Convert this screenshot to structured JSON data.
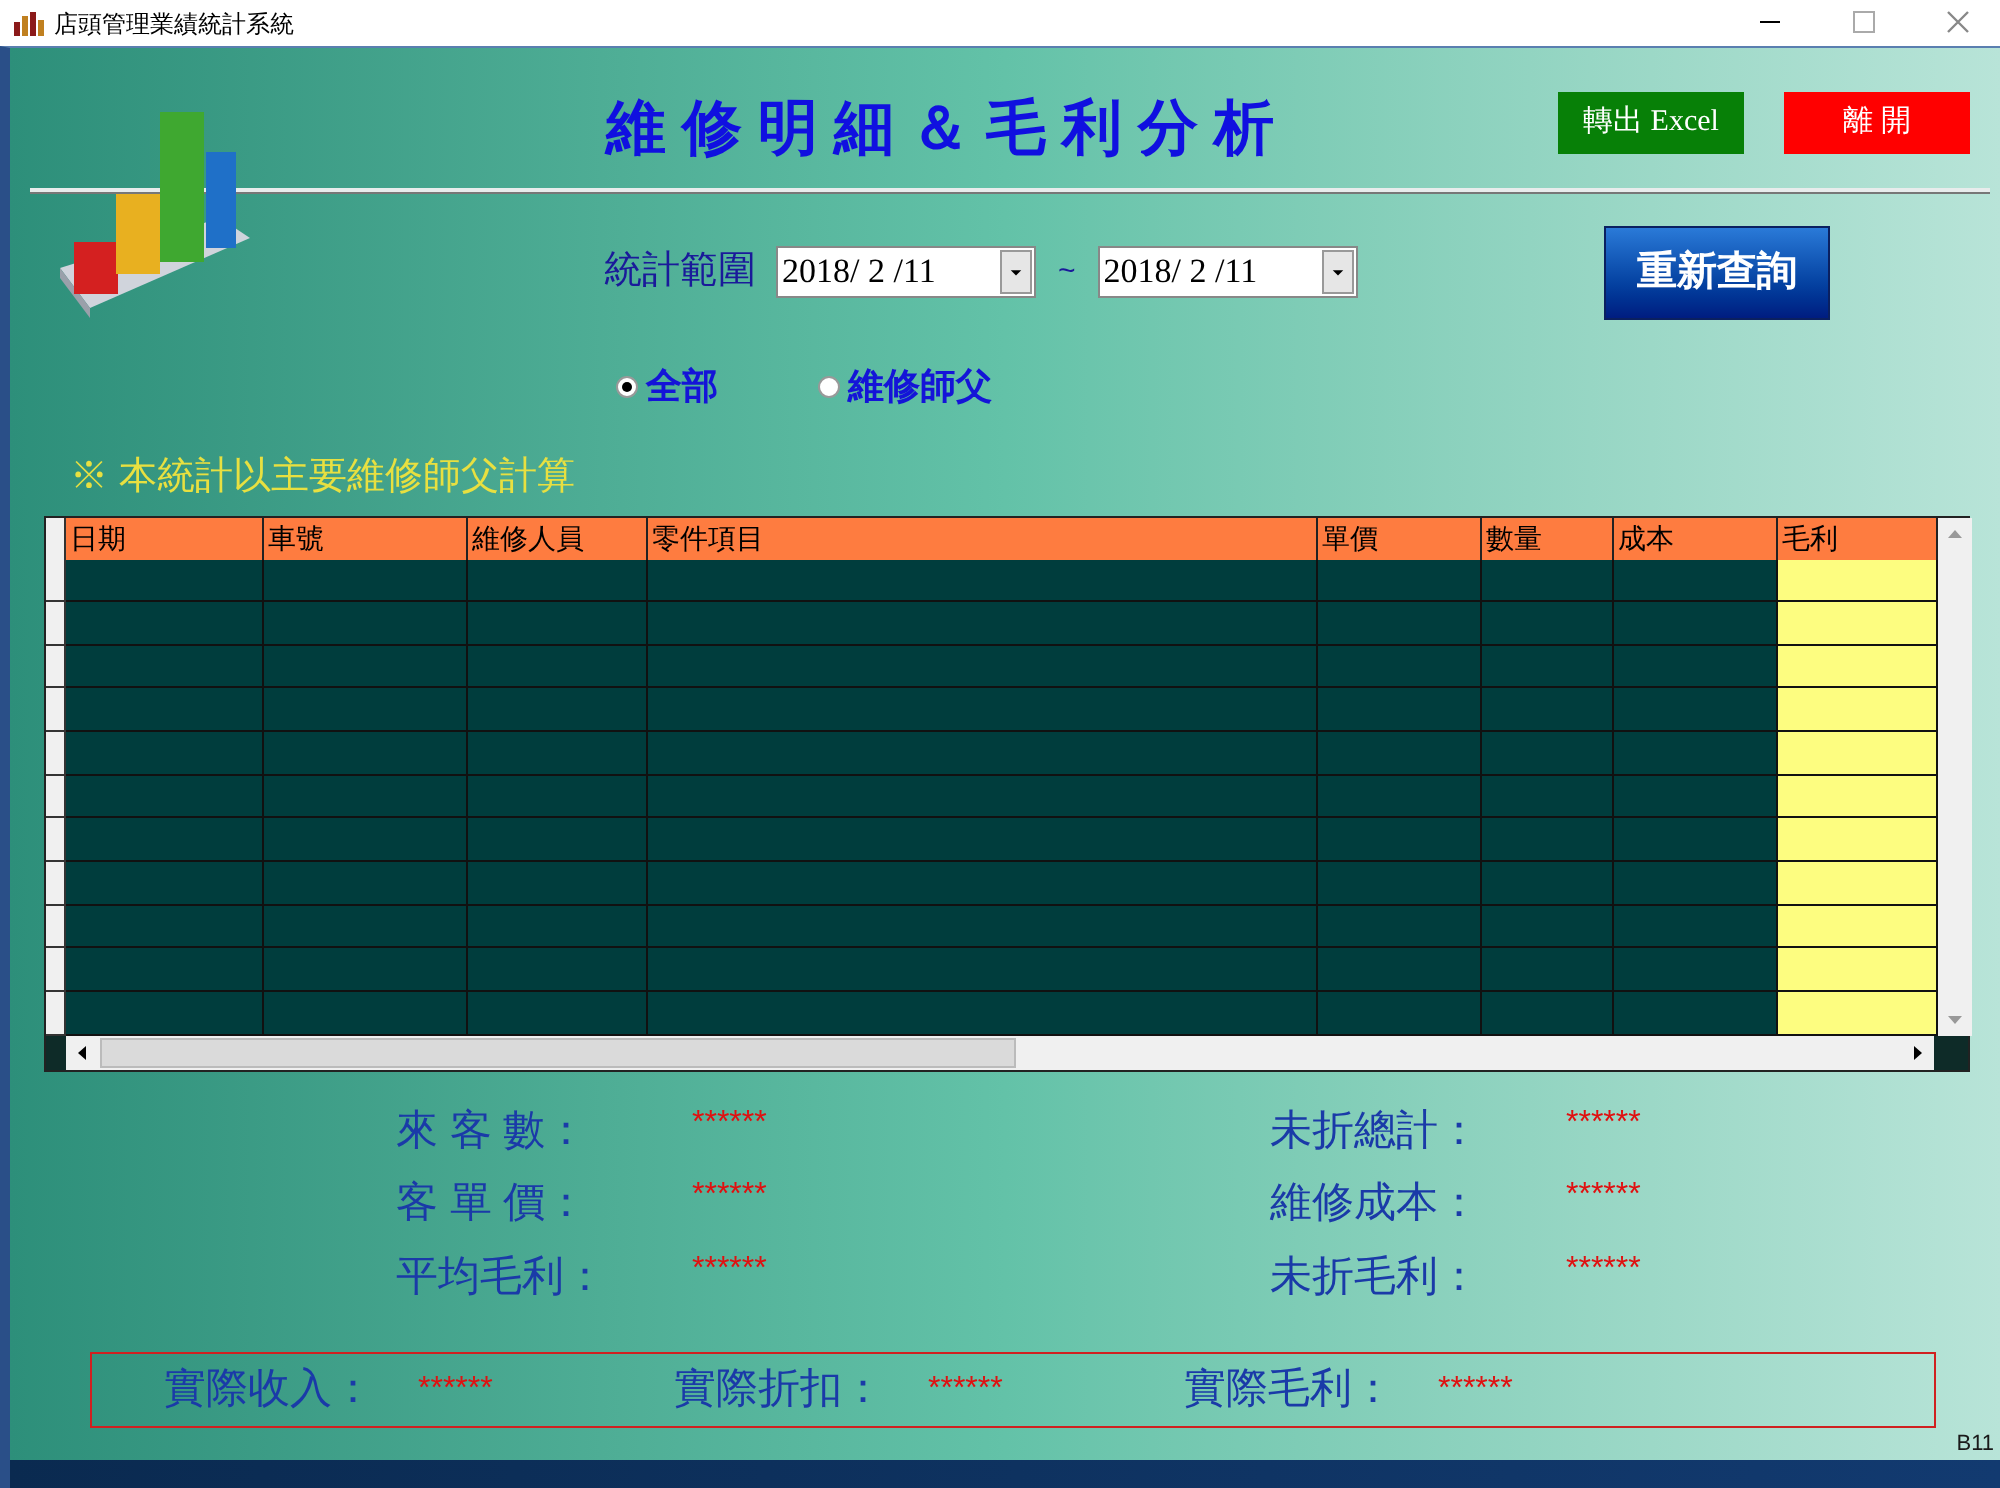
{
  "window": {
    "title": "店頭管理業績統計系統"
  },
  "header": {
    "title": "維修明細＆毛利分析",
    "export_button": "轉出 Excel",
    "exit_button": "離 開"
  },
  "range": {
    "label": "統計範圍",
    "from": "2018/ 2 /11",
    "separator": "~",
    "to": "2018/ 2 /11",
    "query_button": "重新查詢"
  },
  "filter": [
    {
      "label": "全部",
      "selected": true
    },
    {
      "label": "維修師父",
      "selected": false
    }
  ],
  "note": "※  本統計以主要維修師父計算",
  "table": {
    "columns": [
      {
        "label": "日期",
        "highlighted": false
      },
      {
        "label": "車號",
        "highlighted": false
      },
      {
        "label": "維修人員",
        "highlighted": false
      },
      {
        "label": "零件項目",
        "highlighted": false
      },
      {
        "label": "單價",
        "highlighted": false
      },
      {
        "label": "數量",
        "highlighted": false
      },
      {
        "label": "成本",
        "highlighted": false
      },
      {
        "label": "毛利",
        "highlighted": true
      }
    ]
  },
  "summary": [
    {
      "label": "來 客 數：",
      "value": "******"
    },
    {
      "label": "未折總計：",
      "value": "******"
    },
    {
      "label": "客 單 價：",
      "value": "******"
    },
    {
      "label": "維修成本：",
      "value": "******"
    },
    {
      "label": "平均毛利：",
      "value": "******"
    },
    {
      "label": "未折毛利：",
      "value": "******"
    }
  ],
  "totals": [
    {
      "label": "實際收入：",
      "value": "******"
    },
    {
      "label": "實際折扣：",
      "value": "******"
    },
    {
      "label": "實際毛利：",
      "value": "******"
    }
  ],
  "form_code": "B11"
}
